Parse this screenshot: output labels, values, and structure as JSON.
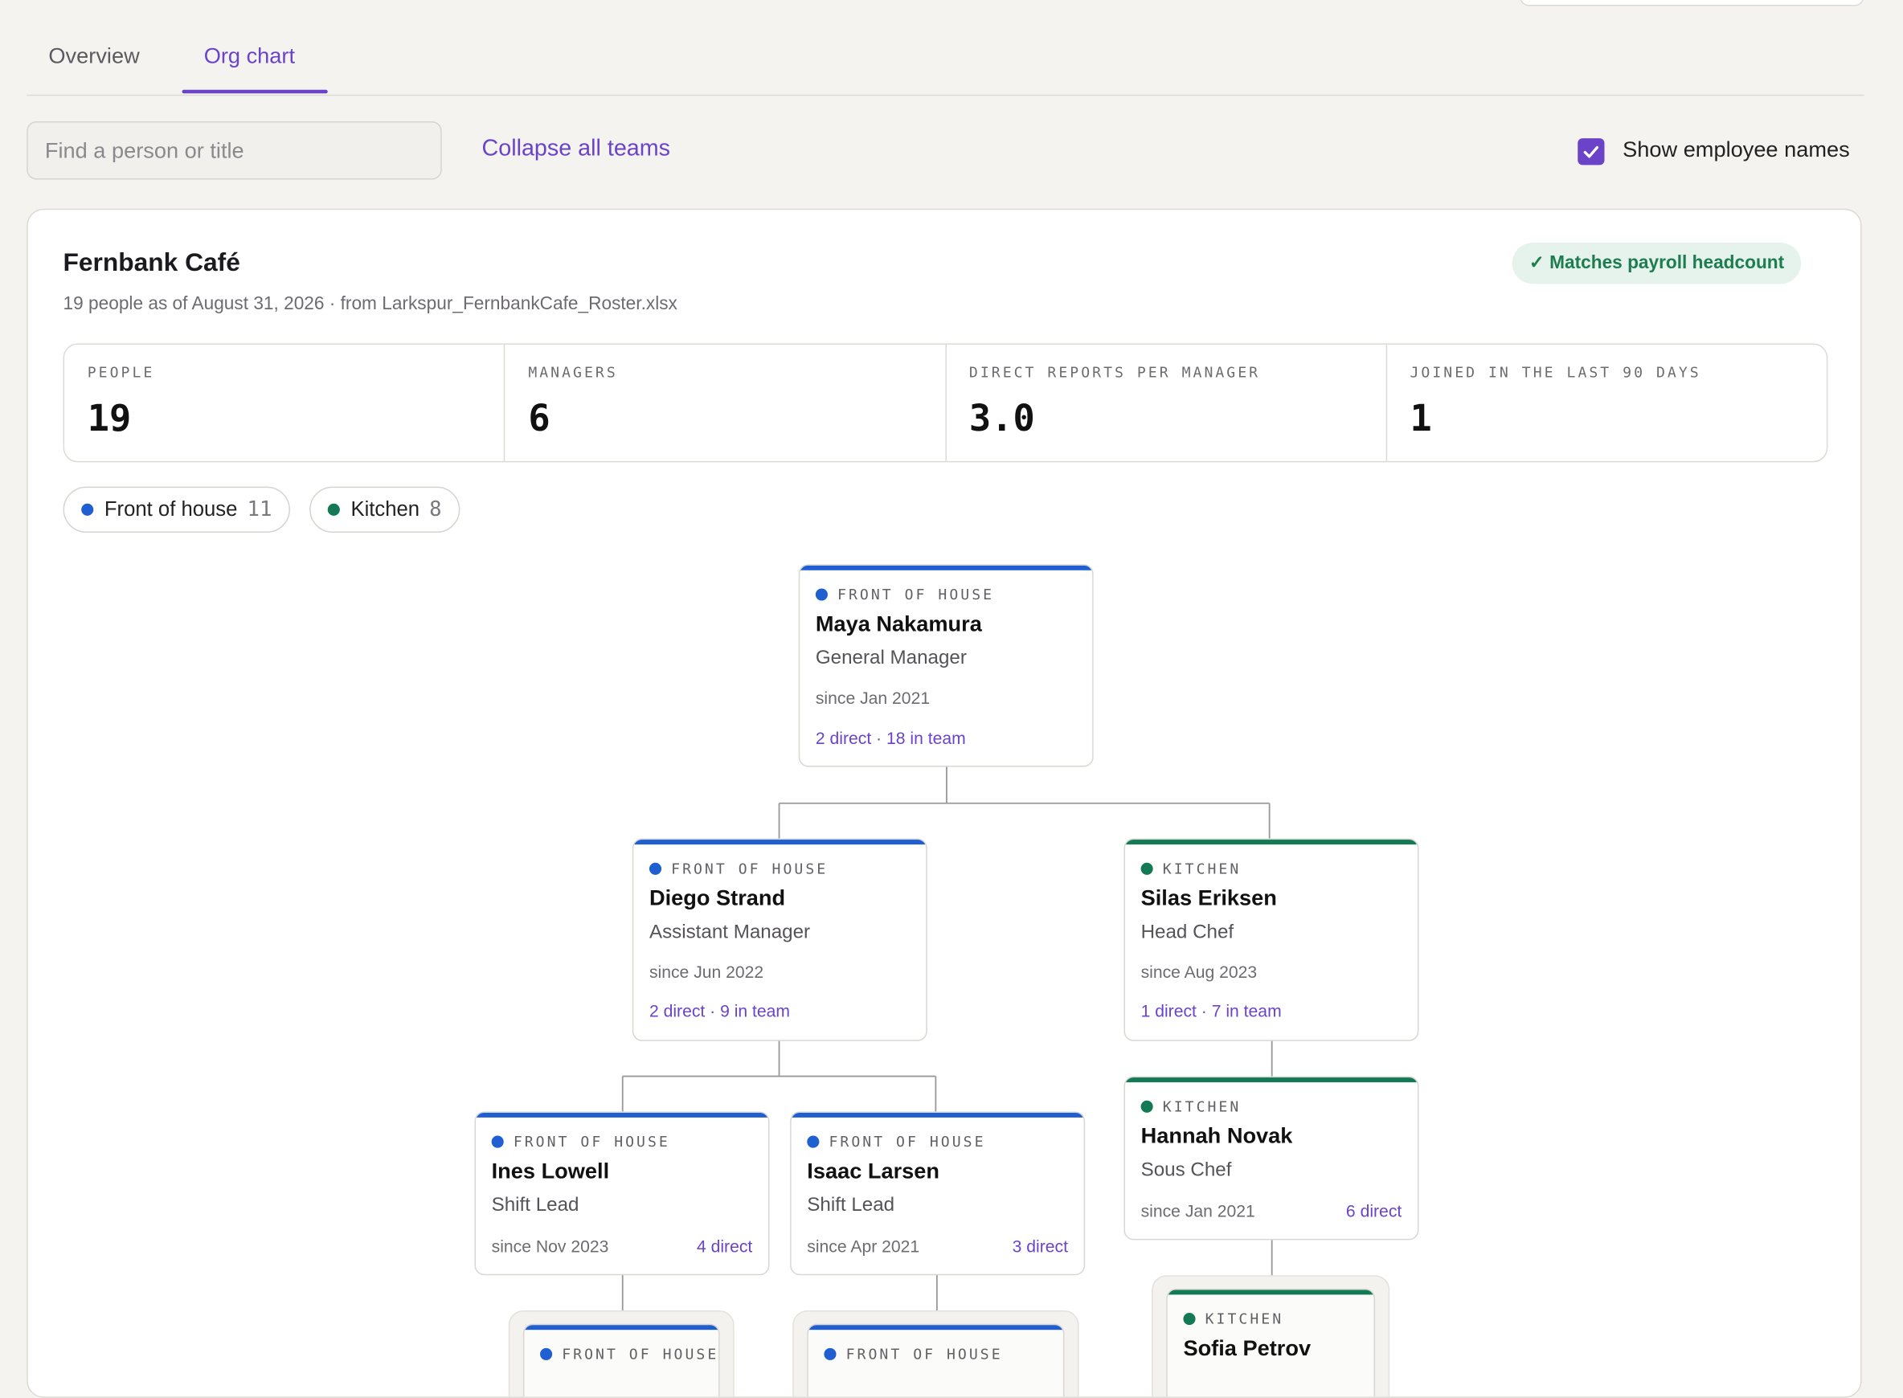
{
  "tabs": [
    {
      "label": "Overview"
    },
    {
      "label": "Org chart"
    }
  ],
  "toolbar": {
    "search_placeholder": "Find a person or title",
    "collapse_label": "Collapse all teams",
    "show_names_label": "Show employee names",
    "show_names_checked": true
  },
  "org": {
    "title": "Fernbank Café",
    "subtitle": "19 people as of August 31, 2026 · from Larkspur_FernbankCafe_Roster.xlsx",
    "badge": "✓ Matches payroll headcount"
  },
  "stats": [
    {
      "label": "PEOPLE",
      "value": "19"
    },
    {
      "label": "MANAGERS",
      "value": "6"
    },
    {
      "label": "DIRECT REPORTS PER MANAGER",
      "value": "3.0"
    },
    {
      "label": "JOINED IN THE LAST 90 DAYS",
      "value": "1"
    }
  ],
  "legend": [
    {
      "label": "Front of house",
      "count": "11",
      "color": "#1f5fd1"
    },
    {
      "label": "Kitchen",
      "count": "8",
      "color": "#137a55"
    }
  ],
  "colors": {
    "accent": "#6a43c9",
    "front_of_house": "#1f5fd1",
    "kitchen": "#137a55"
  },
  "people": [
    {
      "team": "FRONT OF HOUSE",
      "name": "Maya Nakamura",
      "role": "General Manager",
      "since": "since Jan 2021",
      "reports": "2 direct · 18 in team"
    },
    {
      "team": "FRONT OF HOUSE",
      "name": "Diego Strand",
      "role": "Assistant Manager",
      "since": "since Jun 2022",
      "reports": "2 direct · 9 in team"
    },
    {
      "team": "KITCHEN",
      "name": "Silas Eriksen",
      "role": "Head Chef",
      "since": "since Aug 2023",
      "reports": "1 direct · 7 in team"
    },
    {
      "team": "FRONT OF HOUSE",
      "name": "Ines Lowell",
      "role": "Shift Lead",
      "since": "since Nov 2023",
      "reports": "4 direct"
    },
    {
      "team": "FRONT OF HOUSE",
      "name": "Isaac Larsen",
      "role": "Shift Lead",
      "since": "since Apr 2021",
      "reports": "3 direct"
    },
    {
      "team": "KITCHEN",
      "name": "Hannah Novak",
      "role": "Sous Chef",
      "since": "since Jan 2021",
      "reports": "6 direct"
    },
    {
      "team": "FRONT OF HOUSE"
    },
    {
      "team": "FRONT OF HOUSE"
    },
    {
      "team": "KITCHEN",
      "name": "Sofia Petrov"
    }
  ]
}
